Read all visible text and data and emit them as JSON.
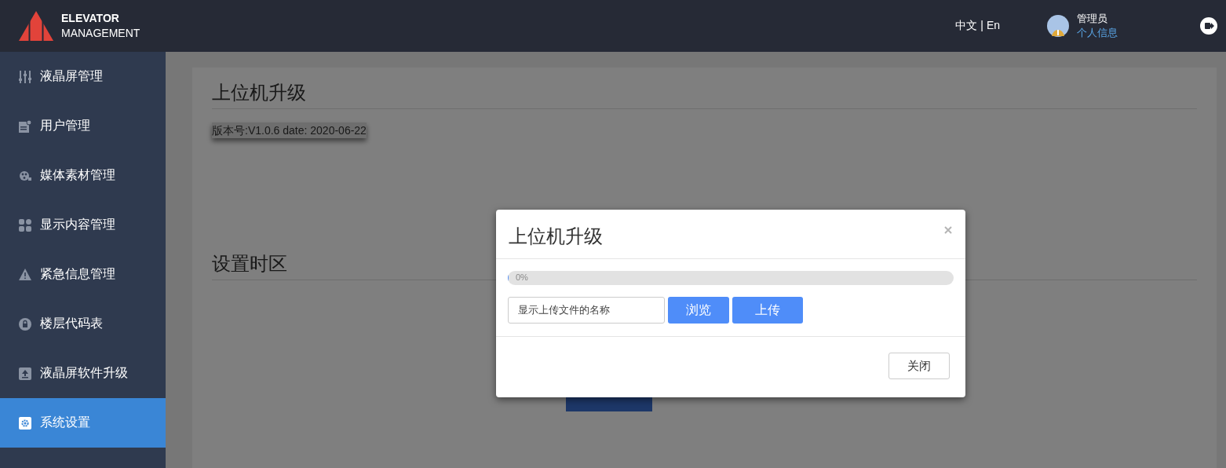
{
  "header": {
    "brand": {
      "line1": "ELEVATOR",
      "line2": "MANAGEMENT"
    },
    "language": {
      "zh": "中文",
      "separator": "|",
      "en": "En"
    },
    "user": {
      "name": "管理员",
      "profile_link": "个人信息"
    }
  },
  "sidebar": {
    "items": [
      {
        "label": "液晶屏管理",
        "selected": false
      },
      {
        "label": "用户管理",
        "selected": false
      },
      {
        "label": "媒体素材管理",
        "selected": false
      },
      {
        "label": "显示内容管理",
        "selected": false
      },
      {
        "label": "紧急信息管理",
        "selected": false
      },
      {
        "label": "楼层代码表",
        "selected": false
      },
      {
        "label": "液晶屏软件升级",
        "selected": false
      },
      {
        "label": "系统设置",
        "selected": true
      }
    ]
  },
  "content": {
    "sections": [
      {
        "title": "上位机升级",
        "version": "版本号:V1.0.6 date: 2020-06-22"
      },
      {
        "title": "设置时区"
      }
    ]
  },
  "modal": {
    "title": "上位机升级",
    "progress": {
      "level": 0,
      "reading": "0%"
    },
    "file_field": {
      "value": "显示上传文件的名称"
    },
    "buttons": [
      {
        "label": "浏览",
        "kind": "primary"
      },
      {
        "label": "上传",
        "kind": "primary"
      }
    ],
    "footer_button": "关闭"
  }
}
